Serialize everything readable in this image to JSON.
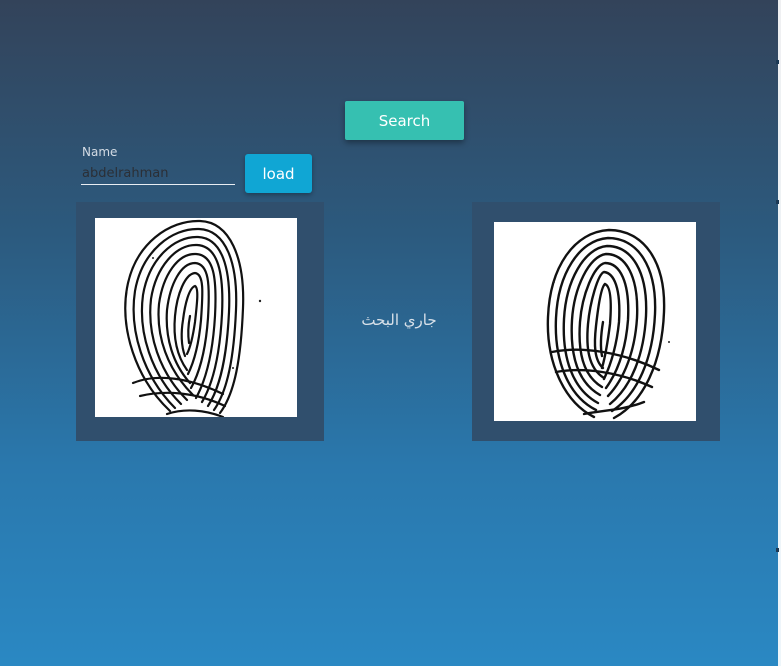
{
  "toolbar": {
    "search_label": "Search"
  },
  "form": {
    "name_label": "Name",
    "name_value": "abdelrahman",
    "load_label": "load"
  },
  "status": {
    "text": "جاري البحث"
  },
  "images": {
    "probe_print": "fingerprint-image",
    "match_print": "fingerprint-image"
  },
  "colors": {
    "search_button": "#36c0b1",
    "load_button": "#10a6d4",
    "frame": "#304f6d",
    "background_top": "#33435a",
    "background_bottom": "#2a88c3"
  }
}
